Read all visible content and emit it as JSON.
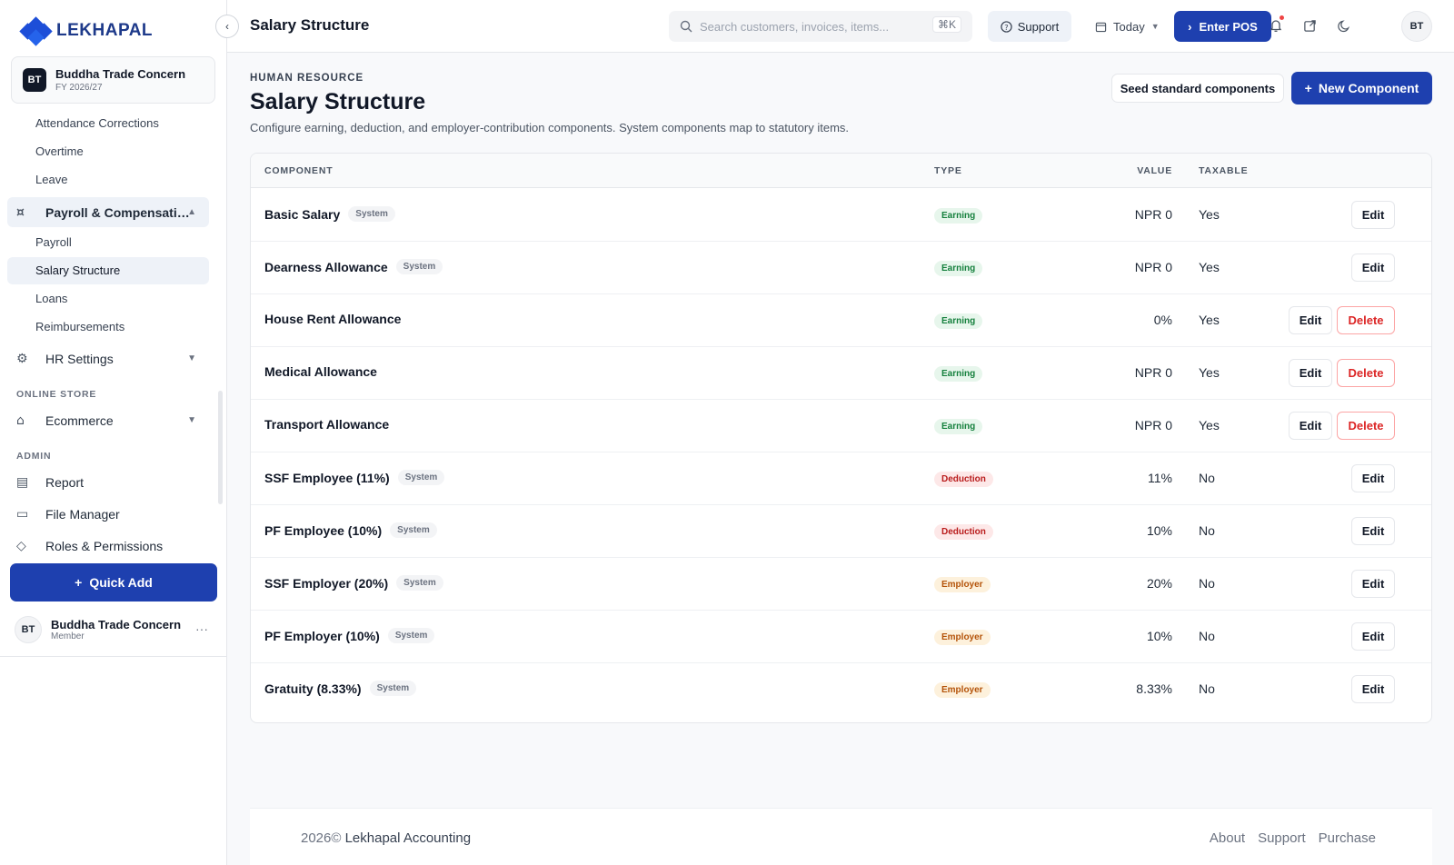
{
  "brand": {
    "name": "LEKHAPAL"
  },
  "org": {
    "initials": "BT",
    "name": "Buddha Trade Concern",
    "fy": "FY 2026/27"
  },
  "sidebar": {
    "items_top": [
      "Attendance Corrections",
      "Overtime",
      "Leave"
    ],
    "payroll_group": {
      "label": "Payroll & Compensati…",
      "icon": "payroll-icon"
    },
    "payroll_items": [
      "Payroll",
      "Salary Structure",
      "Loans",
      "Reimbursements"
    ],
    "hr_settings": "HR Settings",
    "section_online_store": "ONLINE STORE",
    "ecommerce": "Ecommerce",
    "section_admin": "ADMIN",
    "report": "Report",
    "file_manager": "File Manager",
    "roles_partial": "Roles & Permissions",
    "quick_add": "Quick Add",
    "user": {
      "initials": "BT",
      "name": "Buddha Trade Concern",
      "role": "Member",
      "more": "···"
    }
  },
  "topbar": {
    "title": "Salary Structure",
    "search_placeholder": "Search customers, invoices, items...",
    "search_kbd": "⌘K",
    "support": "Support",
    "today": "Today",
    "enter_pos": "Enter POS",
    "avatar": "BT"
  },
  "page": {
    "eyebrow": "HUMAN RESOURCE",
    "title": "Salary Structure",
    "description": "Configure earning, deduction, and employer-contribution components. System components map to statutory items.",
    "seed_button": "Seed standard components",
    "new_button": "New Component"
  },
  "table": {
    "headers": {
      "component": "COMPONENT",
      "type": "TYPE",
      "value": "VALUE",
      "taxable": "TAXABLE"
    },
    "edit_label": "Edit",
    "delete_label": "Delete",
    "rows": [
      {
        "name": "Basic Salary",
        "system": "System",
        "type": "Earning",
        "value": "NPR 0",
        "taxable": "Yes"
      },
      {
        "name": "Dearness Allowance",
        "system": "System",
        "type": "Earning",
        "value": "NPR 0",
        "taxable": "Yes"
      },
      {
        "name": "House Rent Allowance",
        "system": "",
        "type": "Earning",
        "value": "0%",
        "taxable": "Yes"
      },
      {
        "name": "Medical Allowance",
        "system": "",
        "type": "Earning",
        "value": "NPR 0",
        "taxable": "Yes"
      },
      {
        "name": "Transport Allowance",
        "system": "",
        "type": "Earning",
        "value": "NPR 0",
        "taxable": "Yes"
      },
      {
        "name": "SSF Employee (11%)",
        "system": "System",
        "type": "Deduction",
        "value": "11%",
        "taxable": "No"
      },
      {
        "name": "PF Employee (10%)",
        "system": "System",
        "type": "Deduction",
        "value": "10%",
        "taxable": "No"
      },
      {
        "name": "SSF Employer (20%)",
        "system": "System",
        "type": "Employer",
        "value": "20%",
        "taxable": "No"
      },
      {
        "name": "PF Employer (10%)",
        "system": "System",
        "type": "Employer",
        "value": "10%",
        "taxable": "No"
      },
      {
        "name": "Gratuity (8.33%)",
        "system": "System",
        "type": "Employer",
        "value": "8.33%",
        "taxable": "No"
      }
    ]
  },
  "footer": {
    "copyright_year": "2026©",
    "copyright_name": "Lekhapal Accounting",
    "links": [
      "About",
      "Support",
      "Purchase"
    ]
  },
  "colors": {
    "primary": "#1e40af",
    "earning": "#15803d",
    "deduction": "#b91c1c",
    "employer": "#b45309"
  }
}
